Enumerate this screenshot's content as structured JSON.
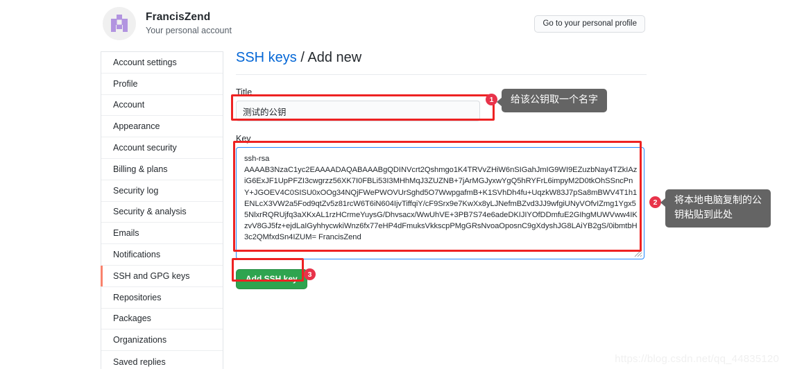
{
  "account": {
    "name": "FrancisZend",
    "subtitle": "Your personal account",
    "avatar_icon": "identicon-avatar",
    "avatar_bg": "#f0f0f0",
    "avatar_fg": "#b294e0",
    "profile_button": "Go to your personal profile"
  },
  "sidebar": {
    "items": [
      {
        "label": "Account settings",
        "active": false
      },
      {
        "label": "Profile",
        "active": false
      },
      {
        "label": "Account",
        "active": false
      },
      {
        "label": "Appearance",
        "active": false
      },
      {
        "label": "Account security",
        "active": false
      },
      {
        "label": "Billing & plans",
        "active": false
      },
      {
        "label": "Security log",
        "active": false
      },
      {
        "label": "Security & analysis",
        "active": false
      },
      {
        "label": "Emails",
        "active": false
      },
      {
        "label": "Notifications",
        "active": false
      },
      {
        "label": "SSH and GPG keys",
        "active": true
      },
      {
        "label": "Repositories",
        "active": false
      },
      {
        "label": "Packages",
        "active": false
      },
      {
        "label": "Organizations",
        "active": false
      },
      {
        "label": "Saved replies",
        "active": false
      }
    ],
    "active_color": "#f9826c"
  },
  "main": {
    "breadcrumb_link": "SSH keys",
    "breadcrumb_sep": " / ",
    "breadcrumb_current": "Add new",
    "link_color": "#0366d6",
    "title_label": "Title",
    "title_value": "测试的公钥",
    "title_placeholder": "",
    "key_label": "Key",
    "key_value": "ssh-rsa\nAAAAB3NzaC1yc2EAAAADAQABAAABgQDINVcrt2Qshmgo1K4TRVvZHiW6nSIGahJmIG9WI9EZuzbNay4TZkIAziG6ExJF1UpPFZI3cwgrzz56XK7I0FBLi53I3MHhMqJ3ZUZNB+7jArMGJyxwYgQ5hRYFrL6impyM2D0tkOhSSncPnY+JGOEV4C0SISU0xOOg34NQjFWePWOVUrSghd5O7WwpgafmB+K1SVhDh4fu+UqzkW83J7pSa8mBWV4T1h1ENLcX3VW2a5Fod9qtZv5z81rcW6T6iN604IjvTiffqiY/cF9Srx9e7KwXx8yLJNefmBZvd3JJ9wfgiUNyVOfvIZmg1Ygx55NlxrRQRUjfq3aXKxAL1rzHCrmeYuysG/Dhvsacx/WwUhVE+3PB7S74e6adeDKIJIYOfDDmfuE2GIhgMUWVww4IKzvV8GJ5fz+ejdLaIGyhhycwkiWnz6fx77eHP4dFmuksVkkscpPMgGRsNvoaOposnC9gXdyshJG8LAiYB2gS/0ibmtbH3c2QMfxdSn4IZUM= FrancisZend",
    "key_placeholder": "",
    "submit_label": "Add SSH key",
    "submit_color": "#2ea44f",
    "focus_border_color": "#2188ff"
  },
  "annotations": {
    "marker_color": "#e8334a",
    "rect_color": "#ee2222",
    "callout_bg": "#646464",
    "items": [
      {
        "number": "1",
        "text": "给该公钥取一个名字"
      },
      {
        "number": "2",
        "text": "将本地电脑复制的公\n钥粘贴到此处"
      },
      {
        "number": "3",
        "text": ""
      }
    ]
  },
  "watermark": "https://blog.csdn.net/qq_44835120"
}
